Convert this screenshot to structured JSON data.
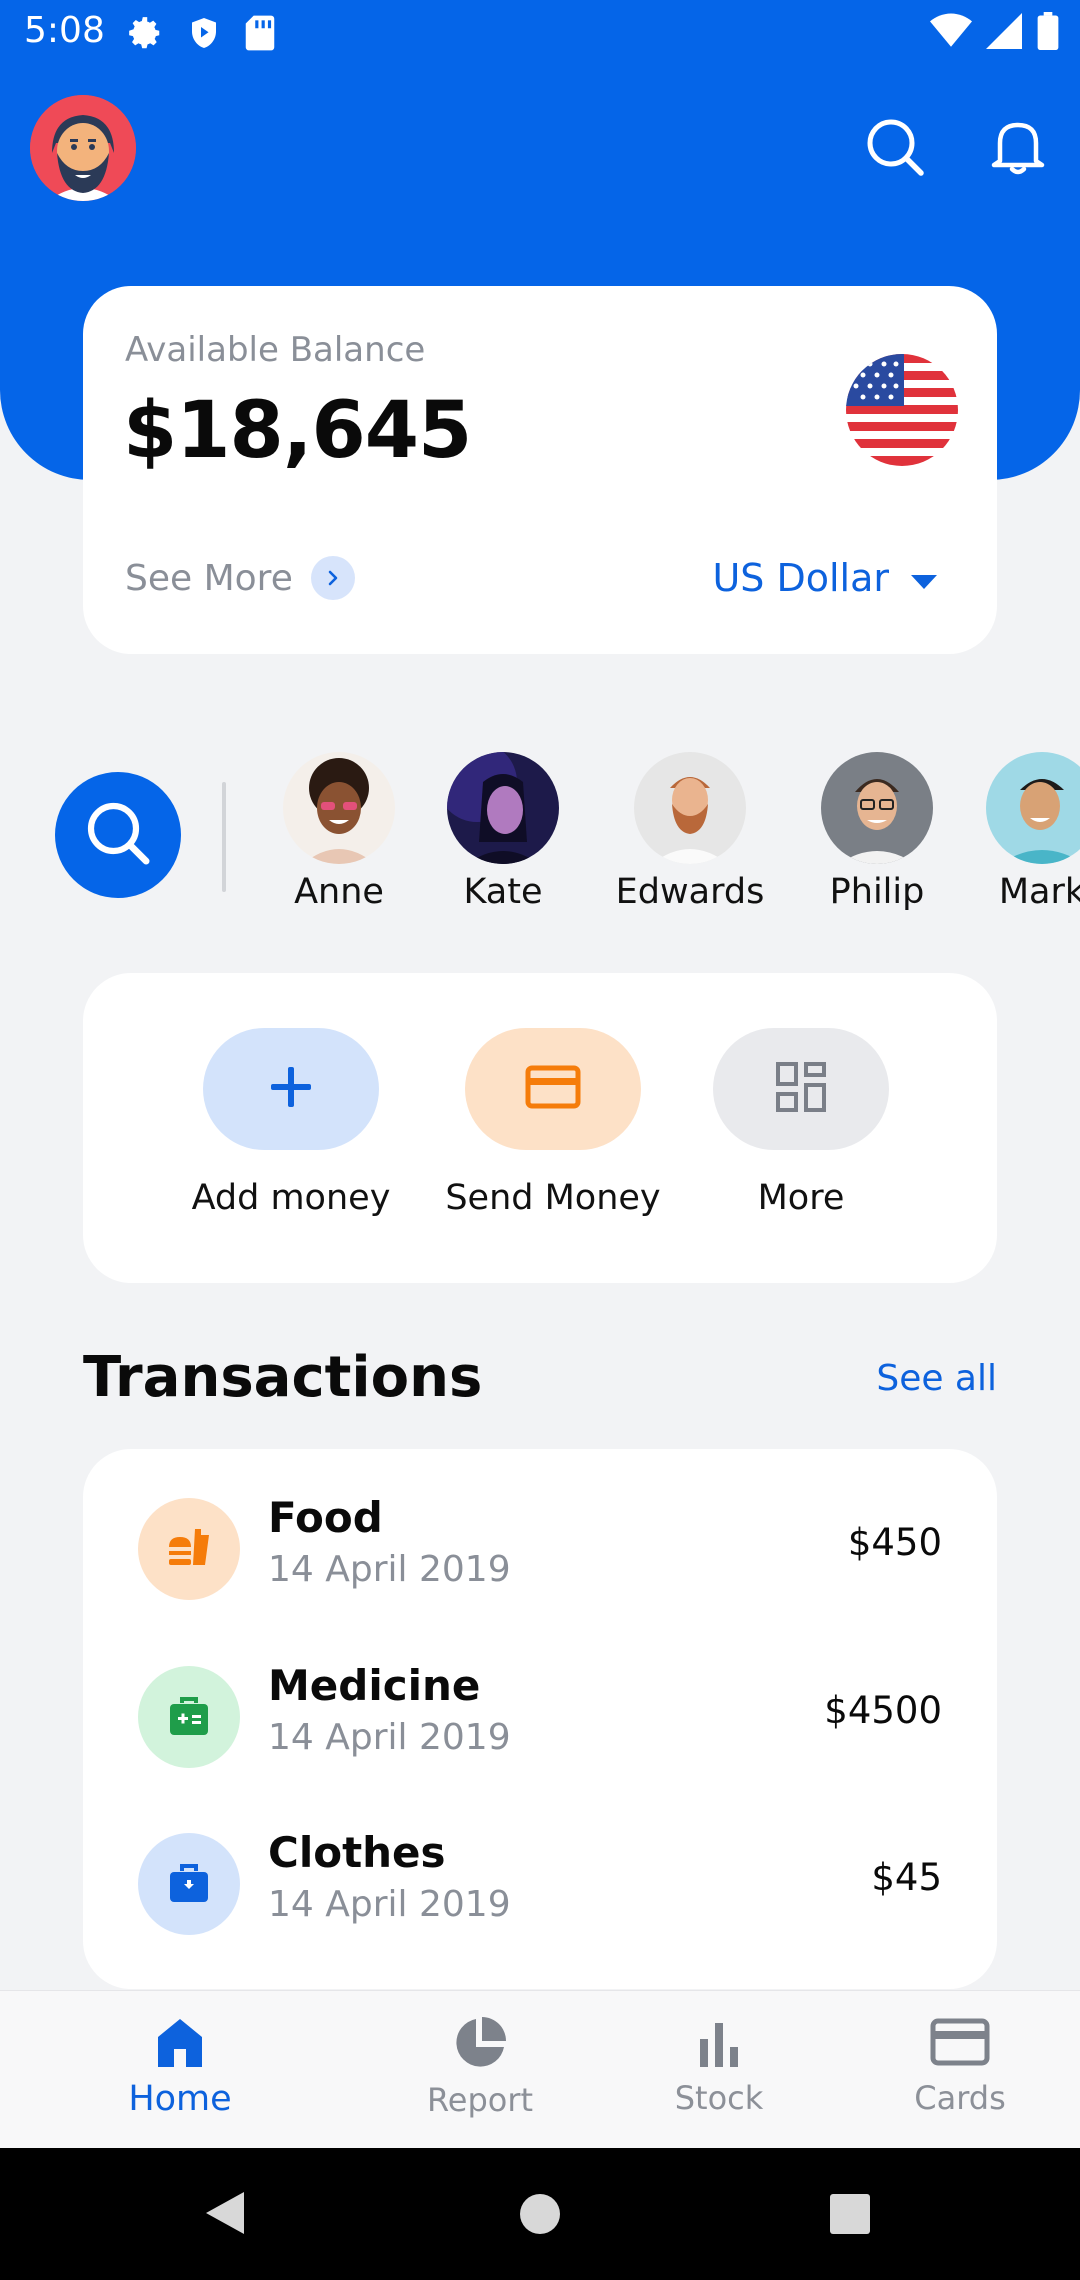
{
  "status_bar": {
    "time": "5:08",
    "left_icons": [
      "gear-icon",
      "shield-icon",
      "sd-card-icon"
    ],
    "right_icons": [
      "wifi-icon",
      "signal-icon",
      "battery-icon"
    ]
  },
  "header": {
    "avatar": "profile-avatar",
    "icons": [
      "search-icon",
      "bell-icon"
    ]
  },
  "balance": {
    "label": "Available Balance",
    "amount": "$18,645",
    "see_more": "See More",
    "currency": "US Dollar",
    "flag": "us-flag"
  },
  "contacts": [
    {
      "name": "Anne"
    },
    {
      "name": "Kate"
    },
    {
      "name": "Edwards"
    },
    {
      "name": "Philip"
    },
    {
      "name": "Mark"
    }
  ],
  "actions": [
    {
      "label": "Add money",
      "icon": "plus-icon"
    },
    {
      "label": "Send Money",
      "icon": "card-icon"
    },
    {
      "label": "More",
      "icon": "grid-icon"
    }
  ],
  "transactions": {
    "title": "Transactions",
    "see_all": "See all",
    "items": [
      {
        "name": "Food",
        "date": "14 April 2019",
        "amount": "$450",
        "icon": "fastfood-icon"
      },
      {
        "name": "Medicine",
        "date": "14 April 2019",
        "amount": "$4500",
        "icon": "medical-kit-icon"
      },
      {
        "name": "Clothes",
        "date": "14 April 2019",
        "amount": "$45",
        "icon": "shopping-bag-icon"
      }
    ]
  },
  "bottom_nav": [
    {
      "label": "Home",
      "icon": "home-icon",
      "active": true
    },
    {
      "label": "Report",
      "icon": "pie-chart-icon",
      "active": false
    },
    {
      "label": "Stock",
      "icon": "bar-chart-icon",
      "active": false
    },
    {
      "label": "Cards",
      "icon": "credit-card-icon",
      "active": false
    }
  ],
  "colors": {
    "primary": "#0565e8",
    "link": "#0d62dd",
    "muted": "#8a8f98",
    "background": "#f2f3f5"
  }
}
